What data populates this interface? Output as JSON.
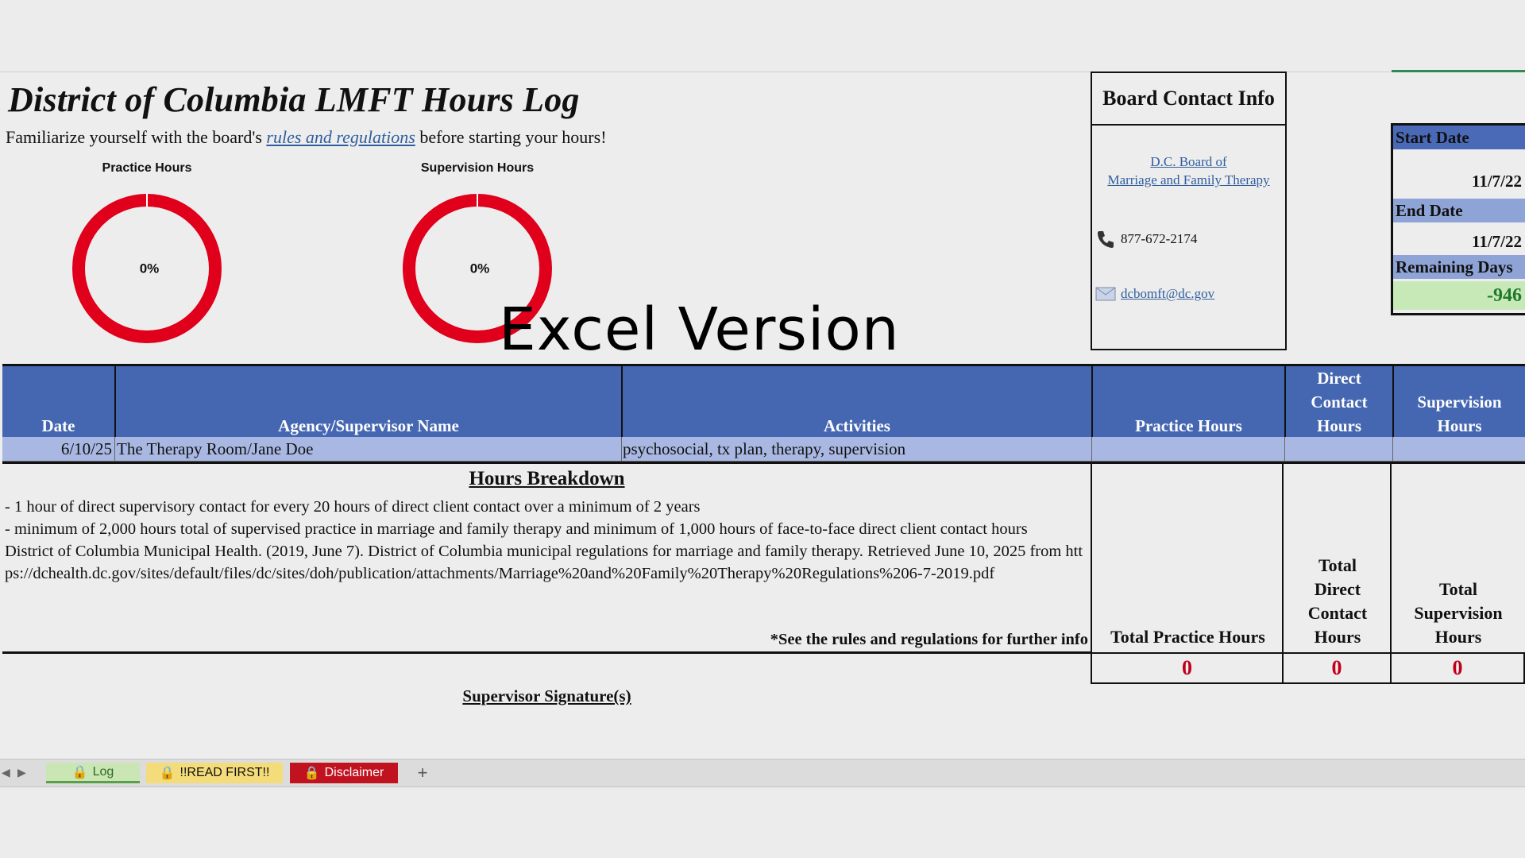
{
  "title": "District of Columbia LMFT Hours Log",
  "subtitle": {
    "before": "Familiarize yourself with the board's ",
    "link": "rules and regulations",
    "after": " before starting your hours!"
  },
  "charts": {
    "practice": {
      "title": "Practice Hours",
      "percent_label": "0%"
    },
    "supervision": {
      "title": "Supervision Hours",
      "percent_label": "0%"
    }
  },
  "chart_data": [
    {
      "type": "pie",
      "title": "Practice Hours",
      "values": [
        0,
        100
      ],
      "center_label": "0%"
    },
    {
      "type": "pie",
      "title": "Supervision Hours",
      "values": [
        0,
        100
      ],
      "center_label": "0%"
    }
  ],
  "watermark": "Excel Version",
  "board": {
    "heading": "Board Contact Info",
    "link_line1": "D.C. Board of",
    "link_line2": "Marriage and Family Therapy",
    "phone": "877-672-2174",
    "email": "dcbomft@dc.gov"
  },
  "dates": {
    "start_label": "Start Date",
    "start_value": "11/7/22",
    "end_label": "End Date",
    "end_value": "11/7/22",
    "remaining_label": "Remaining Days",
    "remaining_value": "-946"
  },
  "table": {
    "headers": {
      "date": "Date",
      "agency": "Agency/Supervisor Name",
      "activities": "Activities",
      "practice": "Practice Hours",
      "direct": "Direct Contact Hours",
      "supervision": "Supervision Hours"
    },
    "row": {
      "date": "6/10/25",
      "agency": "The Therapy Room/Jane Doe",
      "activities": "psychosocial, tx plan, therapy, supervision"
    }
  },
  "breakdown": {
    "title": "Hours Breakdown",
    "line1": "- 1 hour of direct supervisory contact for every 20 hours of direct client contact over a minimum of 2 years",
    "line2": "- minimum of 2,000 hours total of supervised practice in marriage and family therapy and minimum of 1,000 hours of face-to-face direct client contact hours",
    "citation": "District of Columbia Municipal Health. (2019, June 7). District of Columbia municipal regulations for marriage and family therapy. Retrieved June 10, 2025 from https://dchealth.dc.gov/sites/default/files/dc/sites/doh/publication/attachments/Marriage%20and%20Family%20Therapy%20Regulations%206-7-2019.pdf",
    "note": "*See the rules and regulations for further info"
  },
  "totals": {
    "practice_label": "Total Practice Hours",
    "direct_label": "Total Direct Contact Hours",
    "supervision_label": "Total Supervision Hours",
    "practice_value": "0",
    "direct_value": "0",
    "supervision_value": "0"
  },
  "signature_label": "Supervisor Signature(s)",
  "tabs": [
    {
      "label": "Log",
      "color": "#c9e6b4"
    },
    {
      "label": "!!READ FIRST!!",
      "color": "#f4dc7a"
    },
    {
      "label": "Disclaimer",
      "color": "#c1121f"
    }
  ],
  "add_sheet": "+",
  "colors": {
    "header_blue": "#4567b1",
    "row_blue": "#a9b8e3",
    "ring_red": "#e0001b",
    "total_red": "#c0001a",
    "remaining_green": "#c7e9b8"
  }
}
